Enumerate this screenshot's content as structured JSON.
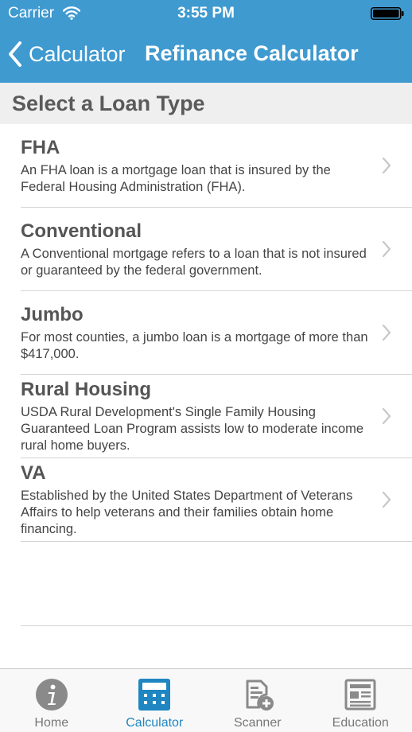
{
  "status_bar": {
    "carrier": "Carrier",
    "time": "3:55 PM"
  },
  "nav": {
    "back_label": "Calculator",
    "title": "Refinance Calculator"
  },
  "section": {
    "title": "Select a Loan Type"
  },
  "loans": [
    {
      "title": "FHA",
      "description": "An FHA loan is a mortgage loan that is insured by the Federal Housing Administration (FHA)."
    },
    {
      "title": "Conventional",
      "description": "A Conventional mortgage refers to a loan that is not insured or guaranteed by the federal government."
    },
    {
      "title": "Jumbo",
      "description": "For most counties, a jumbo loan is a mortgage of more than $417,000."
    },
    {
      "title": "Rural Housing",
      "description": "USDA Rural Development's Single Family Housing Guaranteed Loan Program assists low to moderate income rural home buyers."
    },
    {
      "title": "VA",
      "description": "Established by the United States Department of Veterans Affairs to help veterans and their families obtain home financing."
    }
  ],
  "tabs": [
    {
      "label": "Home",
      "icon": "info-icon",
      "active": false
    },
    {
      "label": "Calculator",
      "icon": "calculator-icon",
      "active": true
    },
    {
      "label": "Scanner",
      "icon": "scanner-icon",
      "active": false
    },
    {
      "label": "Education",
      "icon": "newspaper-icon",
      "active": false
    }
  ],
  "colors": {
    "header": "#3f9ad0",
    "active_tab": "#1f86c2",
    "inactive_tab": "#777777"
  }
}
